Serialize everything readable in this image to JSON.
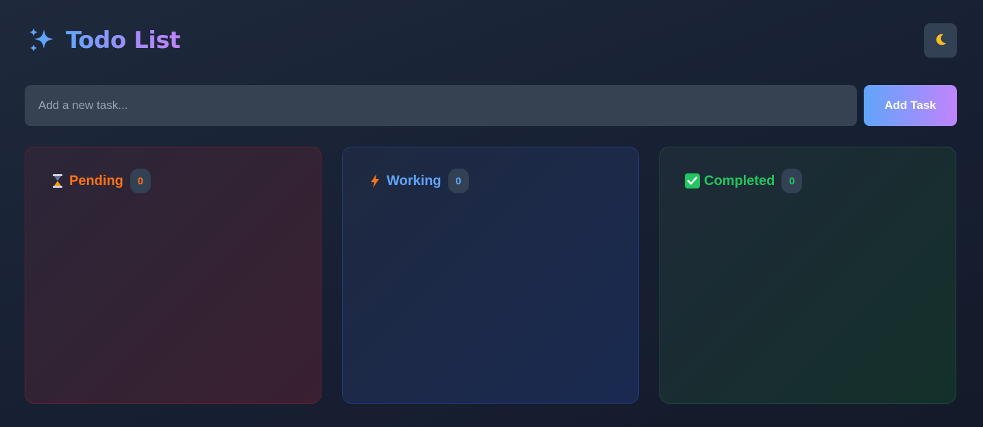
{
  "app": {
    "title": "Todo List",
    "theme_toggle_icon": "moon-icon"
  },
  "add_task": {
    "placeholder": "Add a new task...",
    "value": "",
    "button_label": "Add Task"
  },
  "columns": [
    {
      "title": "Pending",
      "count": "0",
      "icon": "hourglass-icon",
      "color": "#f97316"
    },
    {
      "title": "Working",
      "count": "0",
      "icon": "lightning-icon",
      "color": "#60a5fa"
    },
    {
      "title": "Completed",
      "count": "0",
      "icon": "check-box-icon",
      "color": "#22c55e"
    }
  ],
  "colors": {
    "accent_start": "#60a5fa",
    "accent_end": "#c084fc",
    "background": "#1a2233"
  }
}
